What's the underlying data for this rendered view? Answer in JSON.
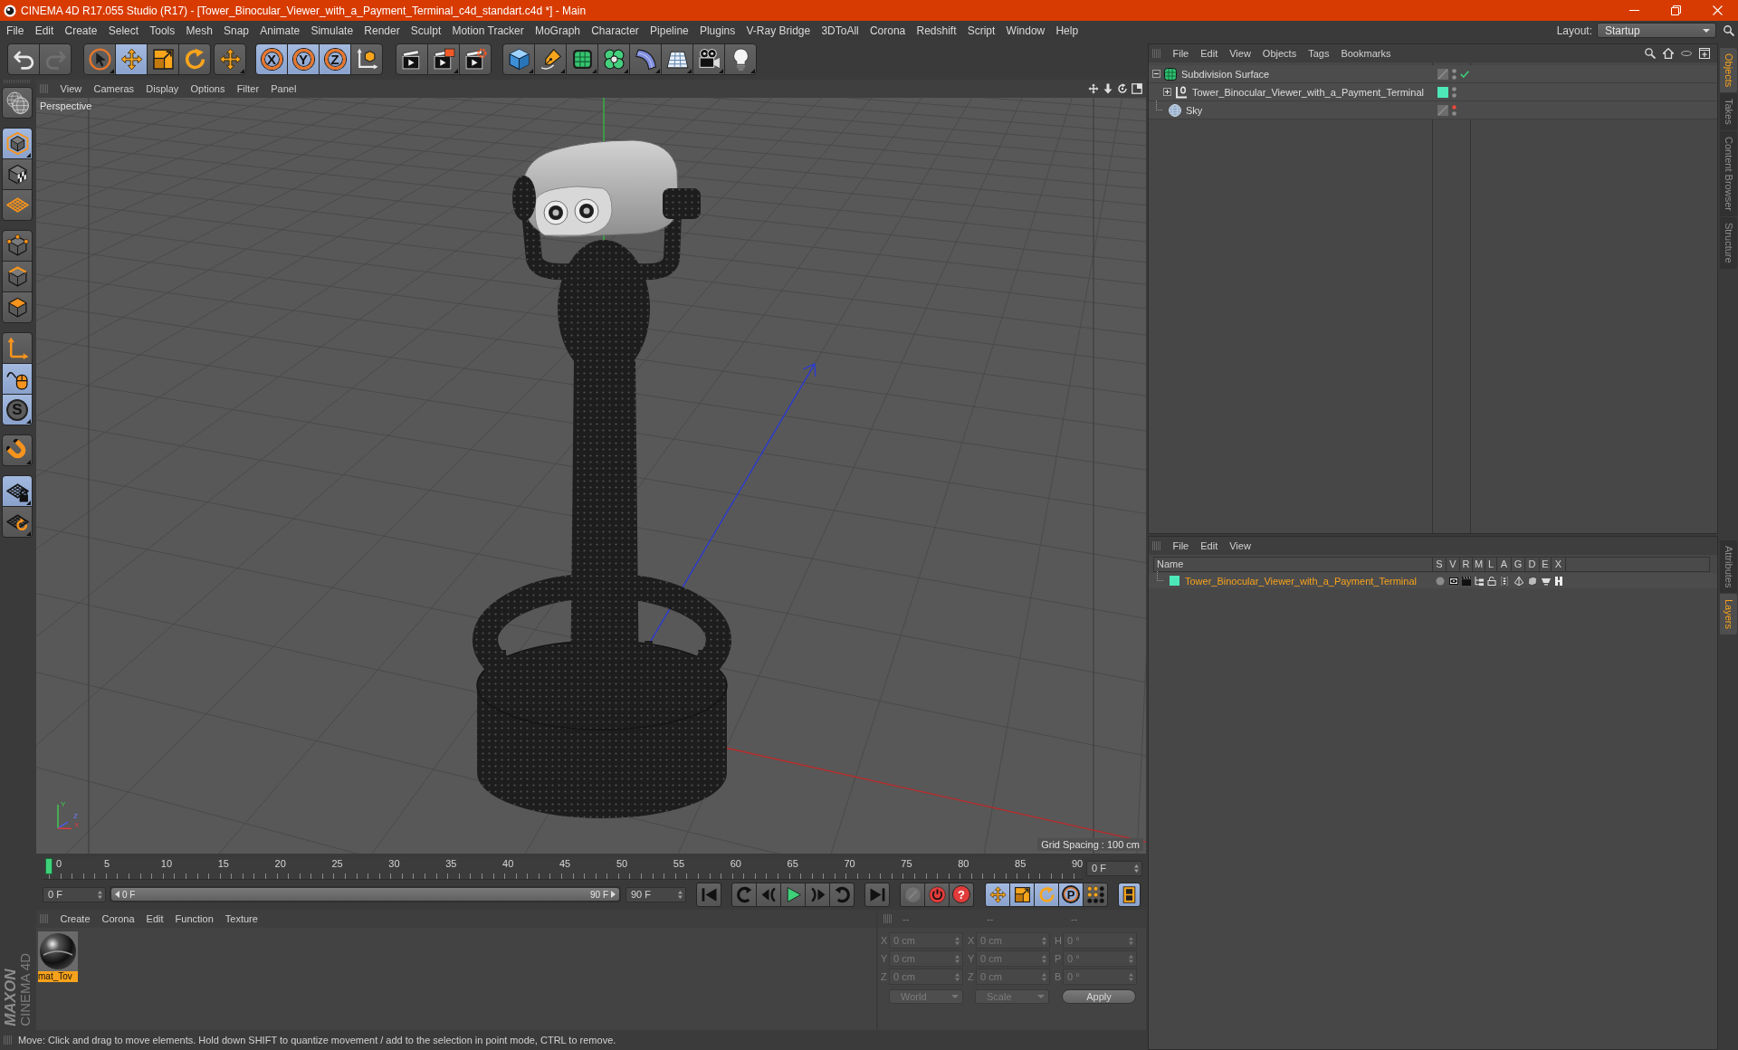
{
  "window": {
    "title": "CINEMA 4D R17.055 Studio (R17) - [Tower_Binocular_Viewer_with_a_Payment_Terminal_c4d_standart.c4d *] - Main"
  },
  "menu_bar": {
    "items": [
      "File",
      "Edit",
      "Create",
      "Select",
      "Tools",
      "Mesh",
      "Snap",
      "Animate",
      "Simulate",
      "Render",
      "Sculpt",
      "Motion Tracker",
      "MoGraph",
      "Character",
      "Pipeline",
      "Plugins",
      "V-Ray Bridge",
      "3DToAll",
      "Corona",
      "Redshift",
      "Script",
      "Window",
      "Help"
    ],
    "layout": {
      "label": "Layout:",
      "value": "Startup"
    }
  },
  "toolbar": {
    "groups": [
      [
        {
          "kind": "undo",
          "selected": false,
          "disabled": false,
          "submenu": false
        },
        {
          "kind": "redo",
          "selected": false,
          "disabled": true,
          "submenu": false
        }
      ],
      [
        {
          "kind": "select",
          "selected": false,
          "disabled": false,
          "submenu": true
        },
        {
          "kind": "move",
          "selected": true,
          "disabled": false,
          "submenu": false
        },
        {
          "kind": "scale",
          "selected": false,
          "disabled": false,
          "submenu": false
        },
        {
          "kind": "rotate",
          "selected": false,
          "disabled": false,
          "submenu": false
        }
      ],
      [
        {
          "kind": "transform",
          "selected": false,
          "disabled": false,
          "submenu": true
        }
      ],
      [
        {
          "kind": "axis",
          "label": "X",
          "selected": true,
          "disabled": false,
          "submenu": false
        },
        {
          "kind": "axis",
          "label": "Y",
          "selected": true,
          "disabled": false,
          "submenu": false
        },
        {
          "kind": "axis",
          "label": "Z",
          "selected": true,
          "disabled": false,
          "submenu": false
        },
        {
          "kind": "coordinates",
          "selected": false,
          "disabled": false,
          "submenu": false
        }
      ],
      [
        {
          "kind": "render-view",
          "selected": false,
          "disabled": false,
          "submenu": false
        },
        {
          "kind": "render-picture",
          "selected": false,
          "disabled": false,
          "submenu": true
        },
        {
          "kind": "render-settings",
          "selected": false,
          "disabled": false,
          "submenu": false
        }
      ],
      [
        {
          "kind": "cube",
          "selected": false,
          "disabled": false,
          "submenu": true
        },
        {
          "kind": "pen",
          "selected": false,
          "disabled": false,
          "submenu": true
        },
        {
          "kind": "subdivision",
          "selected": false,
          "disabled": false,
          "submenu": true
        },
        {
          "kind": "cloner",
          "selected": false,
          "disabled": false,
          "submenu": true
        },
        {
          "kind": "deformer",
          "selected": false,
          "disabled": false,
          "submenu": true
        },
        {
          "kind": "floor",
          "selected": false,
          "disabled": false,
          "submenu": true
        },
        {
          "kind": "camera",
          "selected": false,
          "disabled": false,
          "submenu": true
        },
        {
          "kind": "light",
          "selected": false,
          "disabled": false,
          "submenu": true
        }
      ]
    ]
  },
  "mode_toolbar": {
    "groups": [
      [
        {
          "kind": "make-editable",
          "selected": false,
          "submenu": false
        }
      ],
      [
        {
          "kind": "model",
          "selected": true,
          "submenu": true
        },
        {
          "kind": "texture",
          "selected": false,
          "submenu": false
        },
        {
          "kind": "workplane",
          "selected": false,
          "submenu": false
        }
      ],
      [
        {
          "kind": "points",
          "selected": false,
          "submenu": false
        },
        {
          "kind": "edges",
          "selected": false,
          "submenu": false
        },
        {
          "kind": "polygons",
          "selected": false,
          "submenu": false
        }
      ],
      [
        {
          "kind": "axis-mode",
          "selected": false,
          "submenu": false
        },
        {
          "kind": "tweak",
          "selected": true,
          "submenu": false
        },
        {
          "kind": "snap",
          "label": "S",
          "selected": true,
          "submenu": true
        }
      ],
      [
        {
          "kind": "magnet",
          "selected": false,
          "submenu": true
        }
      ],
      [
        {
          "kind": "lock-grid",
          "selected": true,
          "submenu": true
        },
        {
          "kind": "grid-sync",
          "selected": false,
          "submenu": true
        }
      ]
    ]
  },
  "logo": {
    "brand": "MAXON",
    "product": "CINEMA 4D"
  },
  "viewport": {
    "menu": [
      "View",
      "Cameras",
      "Display",
      "Options",
      "Filter",
      "Panel"
    ],
    "camera": "Perspective",
    "grid_spacing": "Grid Spacing : 100 cm",
    "axis_labels": [
      "Y",
      "Z",
      "X"
    ]
  },
  "timeline": {
    "ticks": [
      "0",
      "5",
      "10",
      "15",
      "20",
      "25",
      "30",
      "35",
      "40",
      "45",
      "50",
      "55",
      "60",
      "65",
      "70",
      "75",
      "80",
      "85",
      "90"
    ],
    "level": 0,
    "current_frame": "0 F"
  },
  "transport": {
    "start_field": "0 F",
    "preview_range": {
      "start": "0 F",
      "end": "90 F",
      "level": 1
    },
    "end_field": "90 F",
    "groups": [
      [
        {
          "kind": "go-start",
          "selected": false,
          "disabled": false
        }
      ],
      [
        {
          "kind": "prev-key",
          "selected": false,
          "disabled": false
        },
        {
          "kind": "prev-frame",
          "selected": false,
          "disabled": false
        },
        {
          "kind": "play",
          "selected": false,
          "disabled": false
        },
        {
          "kind": "next-frame",
          "selected": false,
          "disabled": false
        },
        {
          "kind": "next-key",
          "selected": false,
          "disabled": false
        }
      ],
      [
        {
          "kind": "go-end",
          "selected": false,
          "disabled": false
        }
      ],
      [
        {
          "kind": "keyframe",
          "selected": false,
          "disabled": true
        },
        {
          "kind": "record",
          "selected": false,
          "disabled": false
        },
        {
          "kind": "autokey",
          "label": "?",
          "selected": false,
          "disabled": false
        }
      ],
      [
        {
          "kind": "key-position",
          "selected": true,
          "disabled": false
        },
        {
          "kind": "key-scale",
          "selected": true,
          "disabled": false
        },
        {
          "kind": "key-rotation",
          "selected": true,
          "disabled": false
        },
        {
          "kind": "key-param",
          "label": "P",
          "selected": true,
          "disabled": false
        },
        {
          "kind": "key-points",
          "selected": false,
          "disabled": false
        }
      ],
      [
        {
          "kind": "timeline",
          "selected": true,
          "disabled": false
        }
      ]
    ]
  },
  "material_manager": {
    "menu": [
      "Create",
      "Corona",
      "Edit",
      "Function",
      "Texture"
    ],
    "materials": [
      {
        "name": "mat_Tov",
        "selected": true
      }
    ]
  },
  "coordinates": {
    "disabled": true,
    "headers": [
      "--",
      "--",
      "--"
    ],
    "rows": [
      {
        "position_axis": "X",
        "position": "0 cm",
        "size_axis": "X",
        "size": "0 cm",
        "rotation_axis": "H",
        "rotation": "0 °"
      },
      {
        "position_axis": "Y",
        "position": "0 cm",
        "size_axis": "Y",
        "size": "0 cm",
        "rotation_axis": "P",
        "rotation": "0 °"
      },
      {
        "position_axis": "Z",
        "position": "0 cm",
        "size_axis": "Z",
        "size": "0 cm",
        "rotation_axis": "B",
        "rotation": "0 °"
      }
    ],
    "mode": "World",
    "transform": "Scale",
    "apply": "Apply"
  },
  "status_bar": {
    "text": "Move: Click and drag to move elements. Hold down SHIFT to quantize movement / add to the selection in point mode, CTRL to remove."
  },
  "object_manager": {
    "menu": [
      "File",
      "Edit",
      "View",
      "Objects",
      "Tags",
      "Bookmarks"
    ],
    "objects": [
      {
        "name": "Subdivision Surface",
        "kind": "subdivision",
        "expanded": true,
        "hidden_in_editor": false,
        "hidden_in_render": false,
        "enabled": true,
        "children": [
          {
            "name": "Tower_Binocular_Viewer_with_a_Payment_Terminal",
            "kind": "null",
            "expanded": false,
            "color": "#4de8b8",
            "hidden_in_editor": false,
            "hidden_in_render": false
          }
        ]
      },
      {
        "name": "Sky",
        "kind": "sky",
        "hidden_in_editor": true,
        "hidden_in_render": false
      }
    ]
  },
  "layer_manager": {
    "menu": [
      "File",
      "Edit",
      "View"
    ],
    "columns": [
      "Name",
      "S",
      "V",
      "R",
      "M",
      "L",
      "A",
      "G",
      "D",
      "E",
      "X"
    ],
    "layers": [
      {
        "name": "Tower_Binocular_Viewer_with_a_Payment_Terminal",
        "color": "#4de8b8",
        "selected": true
      }
    ]
  },
  "side_tabs": {
    "top": [
      {
        "label": "Objects",
        "selected": true
      },
      {
        "label": "Takes",
        "selected": false
      },
      {
        "label": "Content Browser",
        "selected": false
      },
      {
        "label": "Structure",
        "selected": false
      }
    ],
    "bottom": [
      {
        "label": "Attributes",
        "selected": false
      },
      {
        "label": "Layers",
        "selected": true
      }
    ]
  }
}
